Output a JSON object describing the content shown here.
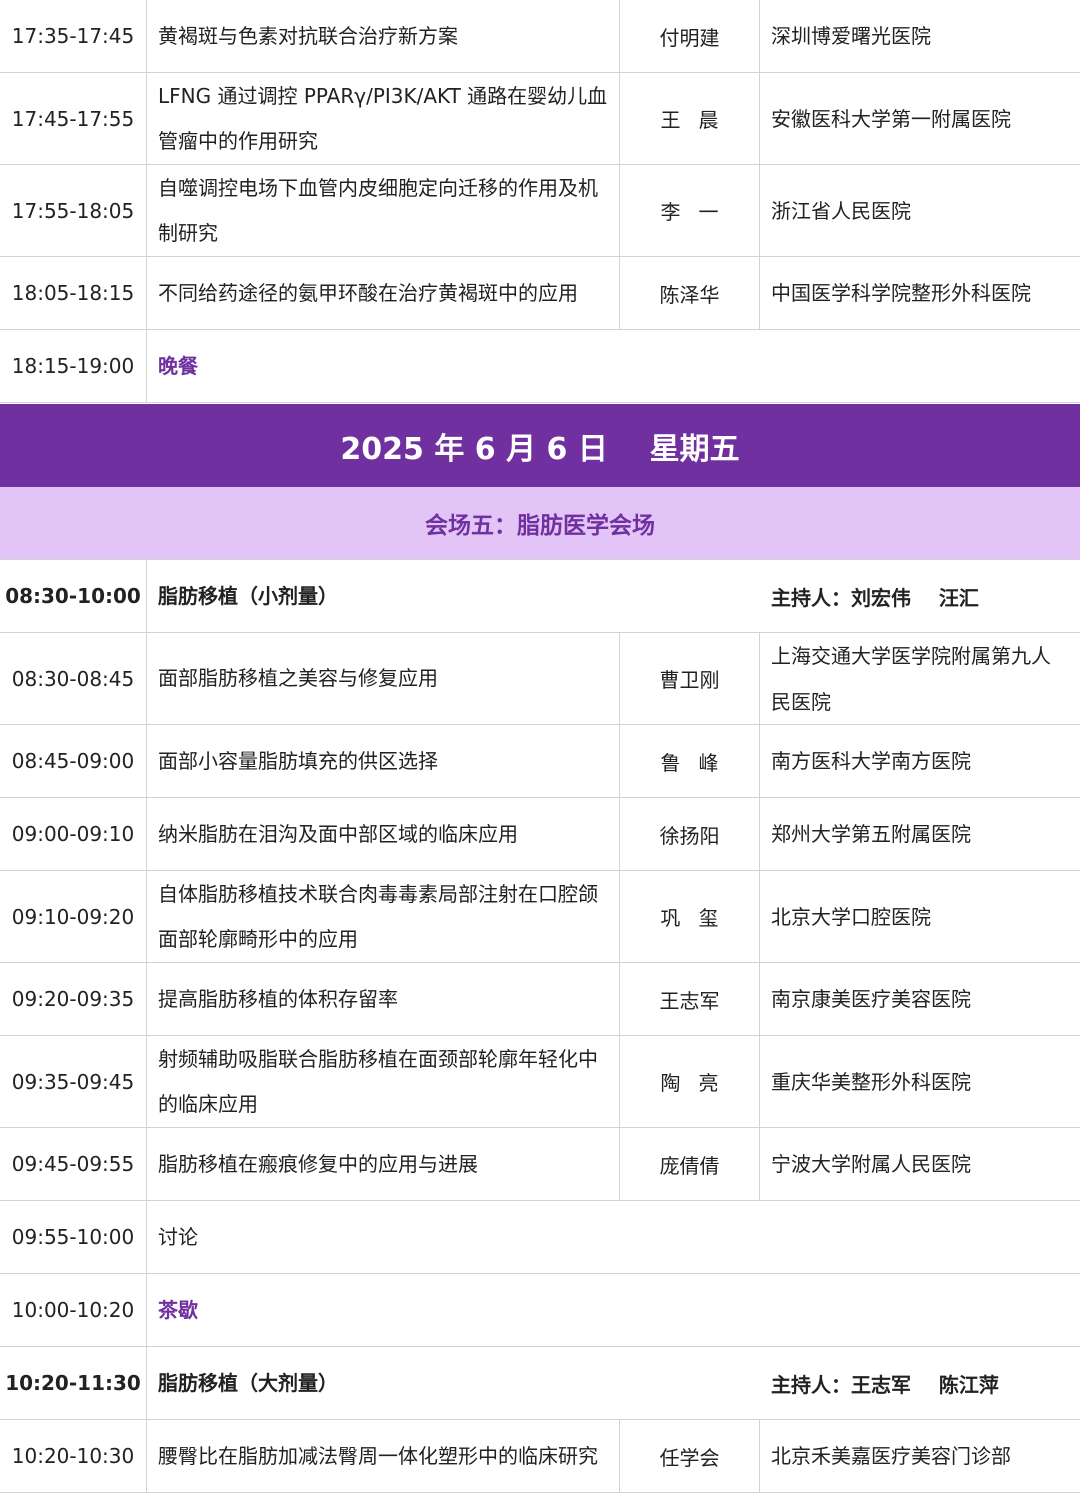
{
  "colors": {
    "accent": "#7030a0",
    "venue_background": "#e2c4f7",
    "grid_line": "#d2d2d2",
    "text": "#222222"
  },
  "rows_before": [
    {
      "kind": "talk",
      "time": "17:35-17:45",
      "topic": "黄褐斑与色素对抗联合治疗新方案",
      "speaker": "付明建",
      "institution": "深圳博爱曙光医院"
    },
    {
      "kind": "talk",
      "time": "17:45-17:55",
      "topic": "LFNG 通过调控 PPARγ/PI3K/AKT 通路在婴幼儿血管瘤中的作用研究",
      "speaker": "王晨",
      "speaker_spaced": true,
      "institution": "安徽医科大学第一附属医院"
    },
    {
      "kind": "talk",
      "time": "17:55-18:05",
      "topic": "自噬调控电场下血管内皮细胞定向迁移的作用及机制研究",
      "speaker": "李一",
      "speaker_spaced": true,
      "institution": "浙江省人民医院"
    },
    {
      "kind": "talk",
      "time": "18:05-18:15",
      "topic": "不同给药途径的氨甲环酸在治疗黄褐斑中的应用",
      "speaker": "陈泽华",
      "institution": "中国医学科学院整形外科医院"
    },
    {
      "kind": "break",
      "time": "18:15-19:00",
      "label": "晚餐"
    }
  ],
  "date_bar": "2025 年 6 月 6 日    星期五",
  "venue_bar": "会场五：脂肪医学会场",
  "rows_after": [
    {
      "kind": "session",
      "time": "08:30-10:00",
      "topic": "脂肪移植（小剂量）",
      "host": "主持人：刘宏伟    汪汇"
    },
    {
      "kind": "talk",
      "time": "08:30-08:45",
      "topic": "面部脂肪移植之美容与修复应用",
      "speaker": "曹卫刚",
      "institution": "上海交通大学医学院附属第九人民医院"
    },
    {
      "kind": "talk",
      "time": "08:45-09:00",
      "topic": "面部小容量脂肪填充的供区选择",
      "speaker": "鲁峰",
      "speaker_spaced": true,
      "institution": "南方医科大学南方医院"
    },
    {
      "kind": "talk",
      "time": "09:00-09:10",
      "topic": "纳米脂肪在泪沟及面中部区域的临床应用",
      "speaker": "徐扬阳",
      "institution": "郑州大学第五附属医院"
    },
    {
      "kind": "talk",
      "time": "09:10-09:20",
      "topic": "自体脂肪移植技术联合肉毒毒素局部注射在口腔颌面部轮廓畸形中的应用",
      "speaker": "巩玺",
      "speaker_spaced": true,
      "institution": "北京大学口腔医院"
    },
    {
      "kind": "talk",
      "time": "09:20-09:35",
      "topic": "提高脂肪移植的体积存留率",
      "speaker": "王志军",
      "institution": "南京康美医疗美容医院"
    },
    {
      "kind": "talk",
      "time": "09:35-09:45",
      "topic": "射频辅助吸脂联合脂肪移植在面颈部轮廓年轻化中的临床应用",
      "speaker": "陶亮",
      "speaker_spaced": true,
      "institution": "重庆华美整形外科医院"
    },
    {
      "kind": "talk",
      "time": "09:45-09:55",
      "topic": "脂肪移植在瘢痕修复中的应用与进展",
      "speaker": "庞倩倩",
      "institution": "宁波大学附属人民医院"
    },
    {
      "kind": "discussion",
      "time": "09:55-10:00",
      "label": "讨论"
    },
    {
      "kind": "break",
      "time": "10:00-10:20",
      "label": "茶歇"
    },
    {
      "kind": "session",
      "time": "10:20-11:30",
      "topic": "脂肪移植（大剂量）",
      "host": "主持人：王志军    陈江萍"
    },
    {
      "kind": "talk",
      "time": "10:20-10:30",
      "topic": "腰臀比在脂肪加减法臀周一体化塑形中的临床研究",
      "speaker": "任学会",
      "institution": "北京禾美嘉医疗美容门诊部"
    }
  ]
}
